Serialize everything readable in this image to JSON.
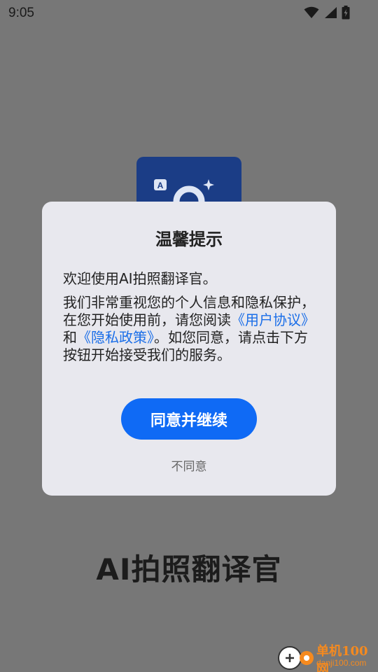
{
  "status_bar": {
    "time": "9:05",
    "icons": [
      "wifi-icon",
      "signal-icon",
      "battery-icon"
    ]
  },
  "background_app": {
    "name": "AI拍照翻译官",
    "logo_icon": "translate-camera-icon",
    "logo_color": "#1b3d86"
  },
  "dialog": {
    "title": "温馨提示",
    "welcome": "欢迎使用AI拍照翻译官。",
    "body_part1": "我们非常重视您的个人信息和隐私保护，在您开始使用前，请您阅读",
    "user_agreement_link": "《用户协议》",
    "body_and": "和",
    "privacy_policy_link": "《隐私政策》",
    "body_part2": "。如您同意，请点击下方按钮开始接受我们的服务。",
    "agree_label": "同意并继续",
    "disagree_label": "不同意",
    "accent_color": "#0f6af5",
    "link_color": "#1a6ee8"
  },
  "watermark": {
    "text_cn": "单机100网",
    "text_en": "danji100.com"
  }
}
